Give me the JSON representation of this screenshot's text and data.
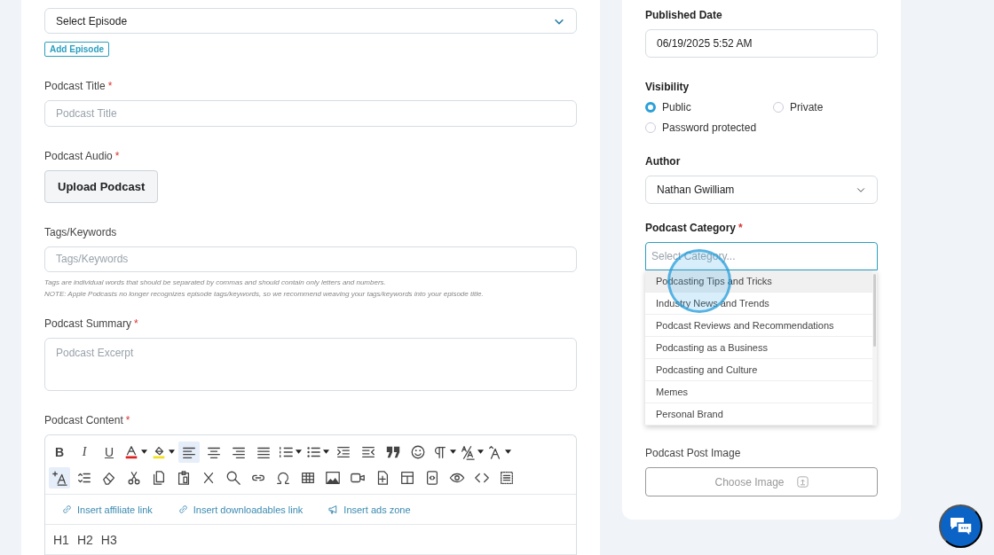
{
  "episode": {
    "select": "Select Episode",
    "add_button": "Add Episode"
  },
  "title": {
    "label": "Podcast Title",
    "required_mark": "*",
    "placeholder": "Podcast Title"
  },
  "audio": {
    "label": "Podcast Audio",
    "required_mark": "*",
    "button": "Upload Podcast"
  },
  "tags": {
    "label": "Tags/Keywords",
    "placeholder": "Tags/Keywords",
    "help": [
      "Tags are individual words that should be separated by commas and should contain only letters and numbers.",
      "NOTE: Apple Podcasts no longer recognizes episode tags/keywords, so we recommend weaving your tags/keywords into your episode title."
    ]
  },
  "summary": {
    "label": "Podcast Summary",
    "required_mark": "*",
    "placeholder": "Podcast Excerpt"
  },
  "content": {
    "label": "Podcast Content",
    "required_mark": "*",
    "toolbar": [
      [
        {
          "kind": "bold",
          "label": "B",
          "selected": false,
          "menu": false
        },
        {
          "kind": "italic",
          "label": "I",
          "selected": false,
          "menu": false
        },
        {
          "kind": "underline",
          "label": "U",
          "selected": false,
          "menu": false
        },
        {
          "kind": "font-color",
          "selected": false,
          "menu": true
        },
        {
          "kind": "highlight",
          "selected": false,
          "menu": true
        },
        {
          "kind": "align-left",
          "selected": true,
          "menu": false
        },
        {
          "kind": "align-center",
          "selected": false,
          "menu": false
        },
        {
          "kind": "align-right",
          "selected": false,
          "menu": false
        },
        {
          "kind": "justify",
          "selected": false,
          "menu": false
        },
        {
          "kind": "ordered-list",
          "selected": false,
          "menu": true
        },
        {
          "kind": "bullet-list",
          "selected": false,
          "menu": true
        },
        {
          "kind": "indent",
          "selected": false,
          "menu": false
        },
        {
          "kind": "outdent",
          "selected": false,
          "menu": false
        },
        {
          "kind": "quote",
          "selected": false,
          "menu": false
        },
        {
          "kind": "emoji",
          "selected": false,
          "menu": false
        },
        {
          "kind": "paragraph",
          "selected": false,
          "menu": true
        },
        {
          "kind": "script",
          "selected": false,
          "menu": true
        },
        {
          "kind": "font-size",
          "selected": false,
          "menu": true
        }
      ],
      [
        {
          "kind": "format",
          "selected": true,
          "menu": false
        },
        {
          "kind": "line-height",
          "selected": false,
          "menu": false
        },
        {
          "kind": "eraser",
          "selected": false,
          "menu": false
        },
        {
          "kind": "cut",
          "selected": false,
          "menu": false
        },
        {
          "kind": "copy",
          "selected": false,
          "menu": false
        },
        {
          "kind": "paste",
          "selected": false,
          "menu": false
        },
        {
          "kind": "clear",
          "selected": false,
          "menu": false
        },
        {
          "kind": "search",
          "selected": false,
          "menu": false
        },
        {
          "kind": "link",
          "selected": false,
          "menu": false
        },
        {
          "kind": "omega",
          "selected": false,
          "menu": false
        },
        {
          "kind": "table",
          "selected": false,
          "menu": false
        },
        {
          "kind": "image",
          "selected": false,
          "menu": false
        },
        {
          "kind": "video",
          "selected": false,
          "menu": false
        },
        {
          "kind": "file-add",
          "selected": false,
          "menu": false
        },
        {
          "kind": "layout",
          "selected": false,
          "menu": false
        },
        {
          "kind": "code-block",
          "selected": false,
          "menu": false
        },
        {
          "kind": "eye",
          "selected": false,
          "menu": false
        },
        {
          "kind": "code",
          "selected": false,
          "menu": false
        },
        {
          "kind": "select-all",
          "selected": false,
          "menu": false
        }
      ]
    ],
    "insert_links": [
      {
        "kind": "link",
        "label": "Insert affiliate link"
      },
      {
        "kind": "link",
        "label": "Insert downloadables link"
      },
      {
        "kind": "megaphone",
        "label": "Insert ads zone"
      }
    ],
    "headings": [
      "H1",
      "H2",
      "H3"
    ]
  },
  "published": {
    "label": "Published Date",
    "value": "06/19/2025 5:52 AM"
  },
  "visibility": {
    "label": "Visibility",
    "options": [
      {
        "label": "Public",
        "selected": true
      },
      {
        "label": "Private",
        "selected": false
      },
      {
        "label": "Password protected",
        "selected": false
      }
    ]
  },
  "author": {
    "label": "Author",
    "value": "Nathan Gwilliam"
  },
  "category": {
    "label": "Podcast Category",
    "required_mark": "*",
    "placeholder": "Select Category...",
    "expanded": true,
    "options": [
      {
        "label": "Podcasting Tips and Tricks",
        "selected": true
      },
      {
        "label": "Industry News and Trends",
        "selected": false
      },
      {
        "label": "Podcast Reviews and Recommendations",
        "selected": false
      },
      {
        "label": "Podcasting as a Business",
        "selected": false
      },
      {
        "label": "Podcasting and Culture",
        "selected": false
      },
      {
        "label": "Memes",
        "selected": false
      },
      {
        "label": "Personal Brand",
        "selected": false
      }
    ]
  },
  "post_image": {
    "label": "Podcast Post Image",
    "button": "Choose Image"
  }
}
